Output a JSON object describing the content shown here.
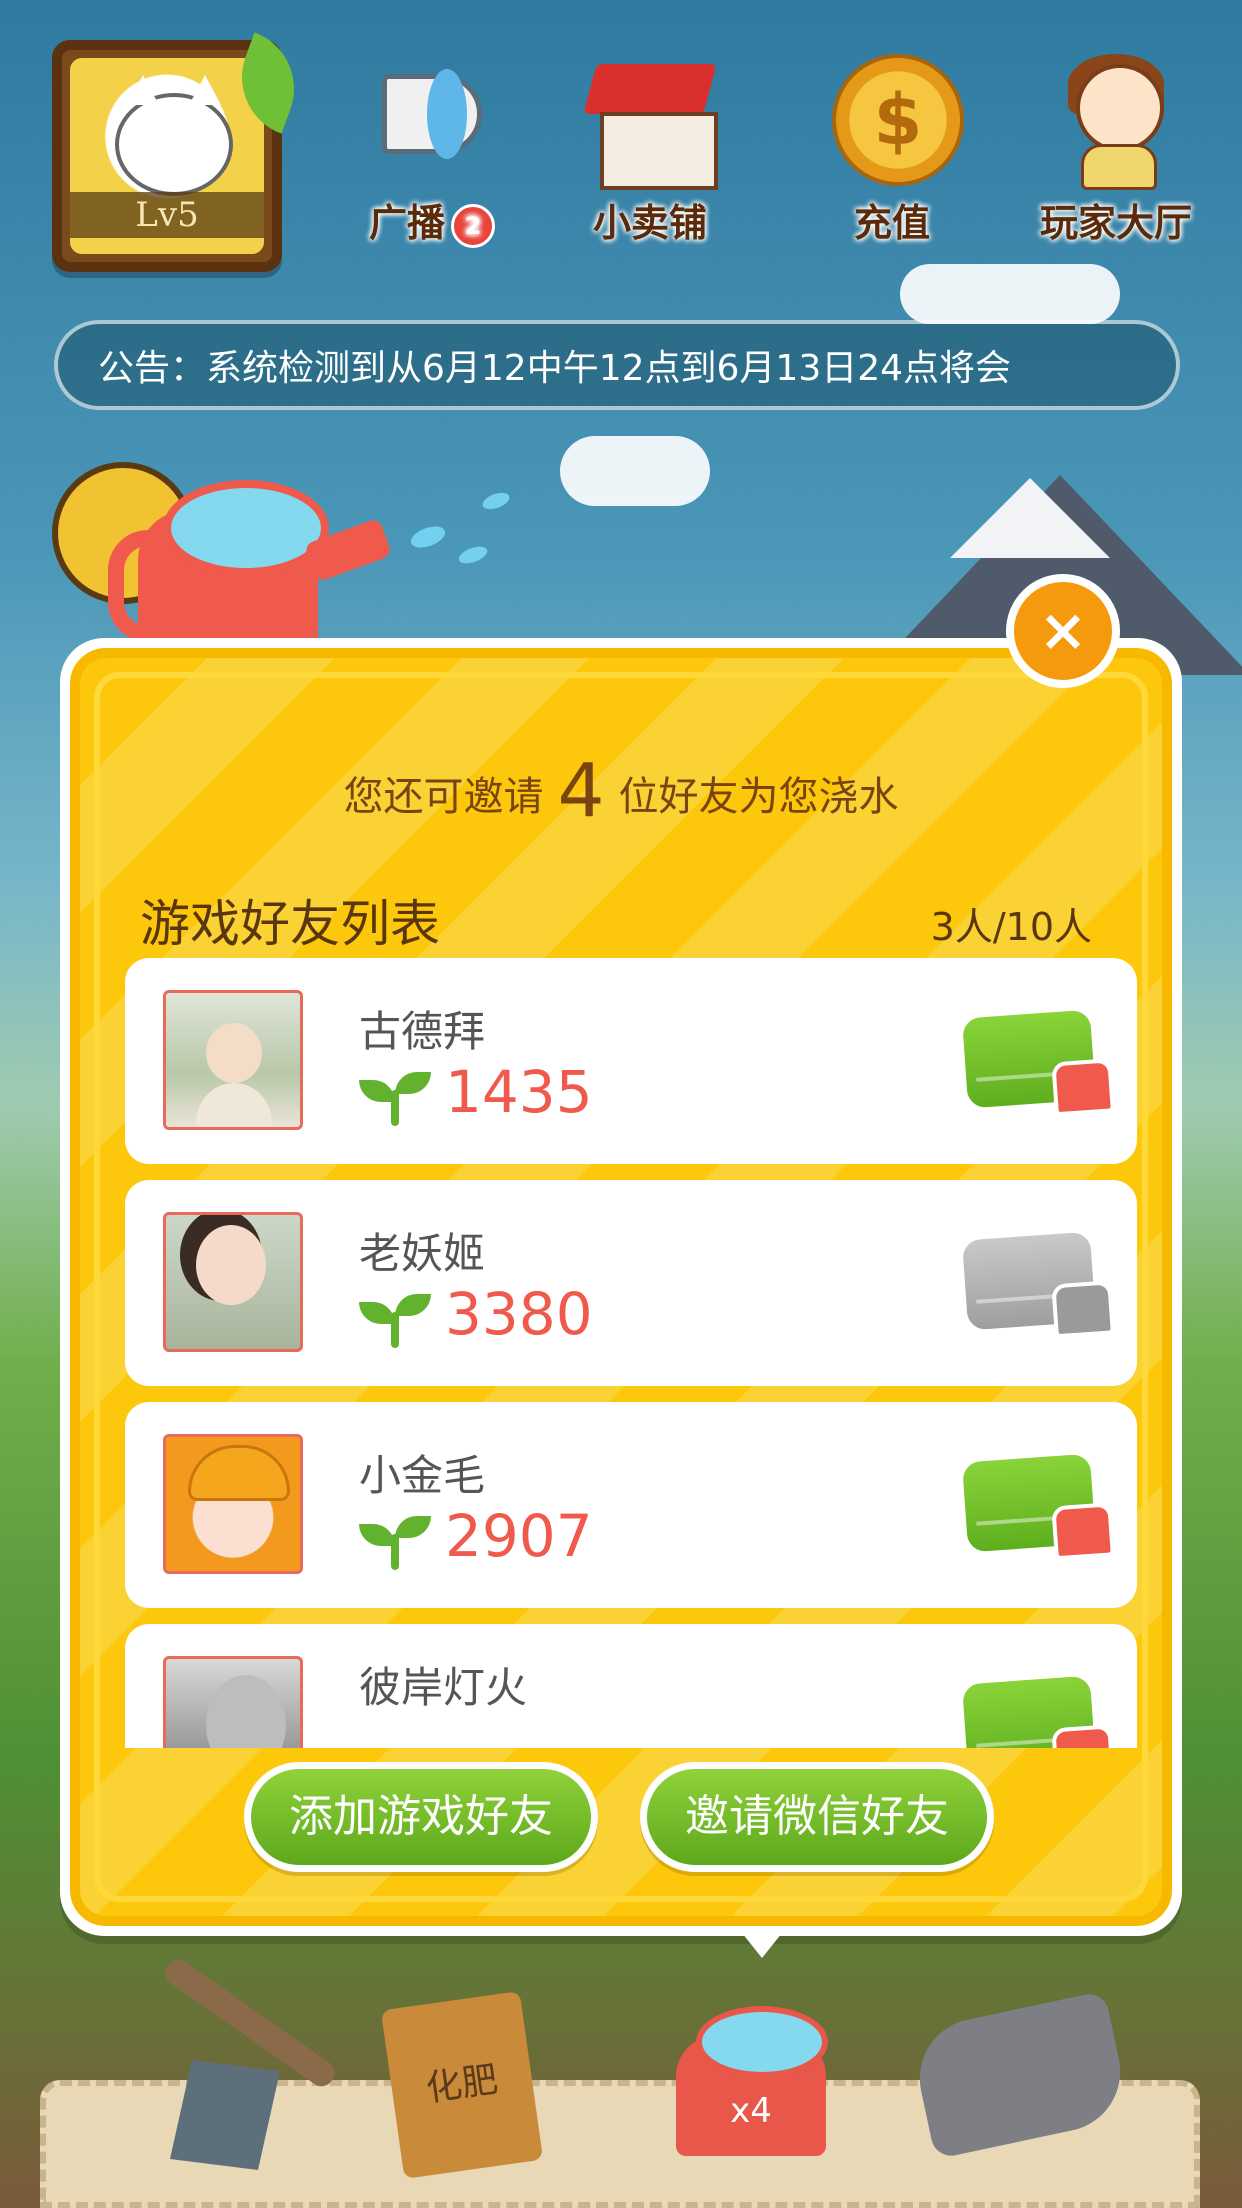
{
  "player": {
    "level_label": "Lv5"
  },
  "top_nav": [
    {
      "label": "广播",
      "badge": "2",
      "icon": "megaphone-icon"
    },
    {
      "label": "小卖铺",
      "icon": "shop-icon"
    },
    {
      "label": "充值",
      "icon": "coin-icon"
    },
    {
      "label": "玩家大厅",
      "icon": "players-icon"
    }
  ],
  "notice": {
    "text": "公告：系统检测到从6月12中午12点到6月13日24点将会"
  },
  "modal": {
    "invite_prefix": "您还可邀请",
    "invite_count": "4",
    "invite_suffix": "位好友为您浇水",
    "list_title": "游戏好友列表",
    "list_count": "3人/10人",
    "friends": [
      {
        "name": "古德拜",
        "score": "1435",
        "water_available": true
      },
      {
        "name": "老妖姬",
        "score": "3380",
        "water_available": false
      },
      {
        "name": "小金毛",
        "score": "2907",
        "water_available": true
      },
      {
        "name": "彼岸灯火",
        "score": "",
        "water_available": true
      }
    ],
    "add_game_friend_label": "添加游戏好友",
    "invite_wechat_label": "邀请微信好友",
    "close_symbol": "×"
  },
  "toolbar": {
    "fertilizer_label": "化肥",
    "water_can_label": "x4"
  },
  "colors": {
    "modal_yellow": "#fdc80b",
    "score_red": "#ef5a4d",
    "button_green": "#6fbe28",
    "close_orange": "#f59a0c"
  }
}
